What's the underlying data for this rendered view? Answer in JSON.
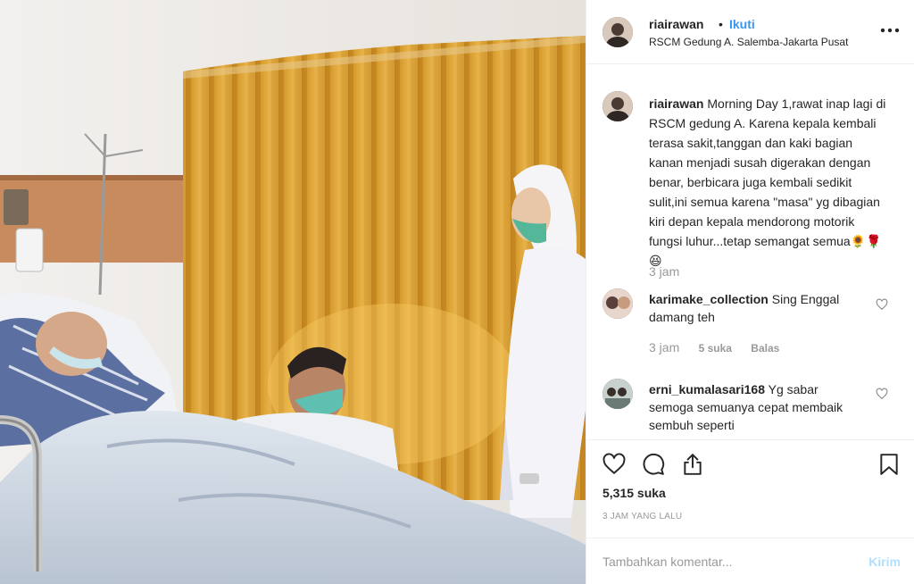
{
  "post": {
    "username": "riairawan",
    "separator": "•",
    "follow_label": "Ikuti",
    "location": "RSCM Gedung A. Salemba-Jakarta Pusat",
    "more_icon": "ellipsis-icon"
  },
  "caption": {
    "username": "riairawan",
    "text": "Morning Day 1,rawat inap lagi di RSCM gedung A. Karena kepala kembali terasa sakit,tanggan dan kaki bagian kanan menjadi susah digerakan dengan benar, berbicara juga kembali sedikit sulit,ini semua karena \"masa\" yg dibagian kiri depan kepala mendorong motorik fungsi luhur...tetap semangat semua🌻🌹😆",
    "time": "3 jam"
  },
  "comments": [
    {
      "username": "karimake_collection",
      "text": "Sing Enggal damang teh",
      "time": "3 jam",
      "likes": "5 suka",
      "reply_label": "Balas"
    },
    {
      "username": "erni_kumalasari168",
      "text": "Yg sabar semoga semuanya cepat membaik sembuh seperti"
    }
  ],
  "actions": {
    "like_icon": "heart-icon",
    "comment_icon": "comment-bubble-icon",
    "share_icon": "share-icon",
    "save_icon": "bookmark-icon",
    "likes_count": "5,315 suka",
    "posted_ago": "3 JAM YANG LALU"
  },
  "add_comment": {
    "placeholder": "Tambahkan komentar...",
    "post_label": "Kirim"
  },
  "colors": {
    "link_blue": "#3897f0",
    "post_button_disabled": "#b2dffc",
    "muted_text": "#999999",
    "curtain": "#d9a030"
  }
}
